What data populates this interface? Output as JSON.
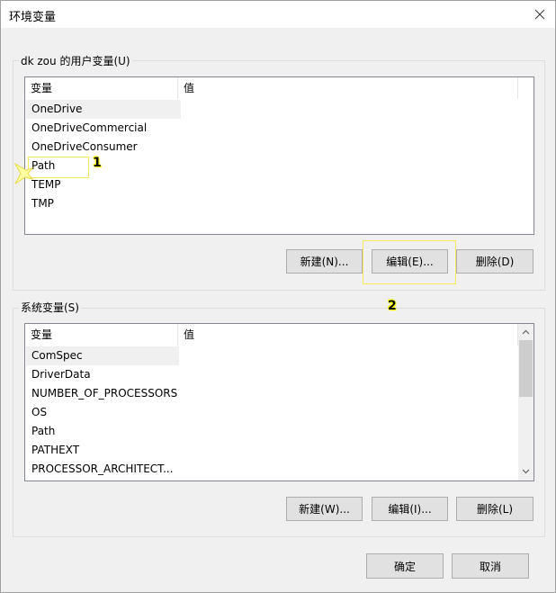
{
  "window": {
    "title": "环境变量"
  },
  "user_vars": {
    "group_label": "dk zou 的用户变量(U)",
    "columns": [
      "变量",
      "值"
    ],
    "rows": [
      "OneDrive",
      "OneDriveCommercial",
      "OneDriveConsumer",
      "Path",
      "TEMP",
      "TMP"
    ],
    "selected_index": 0,
    "buttons": {
      "new": "新建(N)...",
      "edit": "编辑(E)...",
      "delete": "删除(D)"
    }
  },
  "system_vars": {
    "group_label": "系统变量(S)",
    "columns": [
      "变量",
      "值"
    ],
    "rows": [
      "ComSpec",
      "DriverData",
      "NUMBER_OF_PROCESSORS",
      "OS",
      "Path",
      "PATHEXT",
      "PROCESSOR_ARCHITECT..."
    ],
    "selected_index": 0,
    "buttons": {
      "new": "新建(W)...",
      "edit": "编辑(I)...",
      "delete": "删除(L)"
    }
  },
  "footer": {
    "ok": "确定",
    "cancel": "取消"
  },
  "annotations": {
    "step1": "1",
    "step2": "2"
  },
  "colors": {
    "highlight": "#f5ea5a",
    "list_border": "#828790",
    "button_bg": "#e1e1e1"
  }
}
